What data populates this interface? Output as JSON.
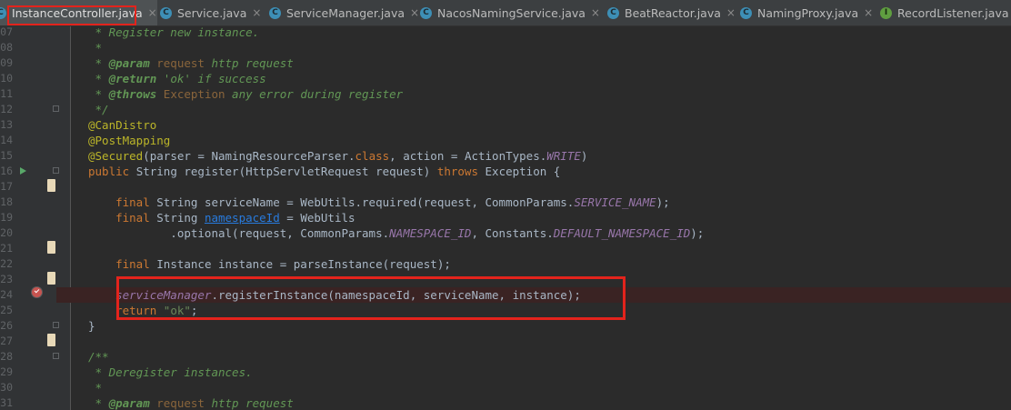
{
  "tabs": [
    {
      "label": "InstanceController.java",
      "icon": "class",
      "active": true
    },
    {
      "label": "Service.java",
      "icon": "class"
    },
    {
      "label": "ServiceManager.java",
      "icon": "class"
    },
    {
      "label": "NacosNamingService.java",
      "icon": "class"
    },
    {
      "label": "BeatReactor.java",
      "icon": "class"
    },
    {
      "label": "NamingProxy.java",
      "icon": "class"
    },
    {
      "label": "RecordListener.java",
      "icon": "interface"
    }
  ],
  "tab_close_glyph": "×",
  "icon_letters": {
    "class": "C",
    "interface": "I"
  },
  "code_lines": [
    {
      "n": "07",
      "parts": [
        {
          "t": " * Register new instance.",
          "c": "cm"
        }
      ]
    },
    {
      "n": "08",
      "parts": [
        {
          "t": " *",
          "c": "cm"
        }
      ]
    },
    {
      "n": "09",
      "parts": [
        {
          "t": " * ",
          "c": "cm"
        },
        {
          "t": "@param",
          "c": "ctag"
        },
        {
          "t": " request",
          "c": "cref"
        },
        {
          "t": " http request",
          "c": "cm"
        }
      ]
    },
    {
      "n": "10",
      "parts": [
        {
          "t": " * ",
          "c": "cm"
        },
        {
          "t": "@return",
          "c": "ctag"
        },
        {
          "t": " 'ok' if success",
          "c": "cm"
        }
      ]
    },
    {
      "n": "11",
      "parts": [
        {
          "t": " * ",
          "c": "cm"
        },
        {
          "t": "@throws",
          "c": "ctag"
        },
        {
          "t": " Exception",
          "c": "cref"
        },
        {
          "t": " any error during register",
          "c": "cm"
        }
      ]
    },
    {
      "n": "12",
      "parts": [
        {
          "t": " */",
          "c": "cm"
        }
      ]
    },
    {
      "n": "13",
      "parts": [
        {
          "t": "@CanDistro",
          "c": "ann"
        }
      ]
    },
    {
      "n": "14",
      "parts": [
        {
          "t": "@PostMapping",
          "c": "ann"
        }
      ]
    },
    {
      "n": "15",
      "parts": [
        {
          "t": "@Secured",
          "c": "ann"
        },
        {
          "t": "(parser = NamingResourceParser."
        },
        {
          "t": "class",
          "c": "kw"
        },
        {
          "t": ", action = ActionTypes."
        },
        {
          "t": "WRITE",
          "c": "cst"
        },
        {
          "t": ")"
        }
      ]
    },
    {
      "n": "16",
      "parts": [
        {
          "t": "public ",
          "c": "kw"
        },
        {
          "t": "String register(HttpServletRequest request) "
        },
        {
          "t": "throws ",
          "c": "kw"
        },
        {
          "t": "Exception {"
        }
      ]
    },
    {
      "n": "17",
      "parts": []
    },
    {
      "n": "18",
      "parts": [
        {
          "t": "    "
        },
        {
          "t": "final ",
          "c": "kw"
        },
        {
          "t": "String serviceName = WebUtils.required(request, CommonParams."
        },
        {
          "t": "SERVICE_NAME",
          "c": "cst"
        },
        {
          "t": ");"
        }
      ]
    },
    {
      "n": "19",
      "parts": [
        {
          "t": "    "
        },
        {
          "t": "final ",
          "c": "kw"
        },
        {
          "t": "String "
        },
        {
          "t": "namespaceId",
          "c": "ulink"
        },
        {
          "t": " = WebUtils"
        }
      ]
    },
    {
      "n": "20",
      "parts": [
        {
          "t": "            .optional(request, CommonParams."
        },
        {
          "t": "NAMESPACE_ID",
          "c": "cst"
        },
        {
          "t": ", Constants."
        },
        {
          "t": "DEFAULT_NAMESPACE_ID",
          "c": "cst"
        },
        {
          "t": ");"
        }
      ]
    },
    {
      "n": "21",
      "parts": []
    },
    {
      "n": "22",
      "parts": [
        {
          "t": "    "
        },
        {
          "t": "final ",
          "c": "kw"
        },
        {
          "t": "Instance instance = parseInstance(request);"
        }
      ]
    },
    {
      "n": "23",
      "parts": []
    },
    {
      "n": "24",
      "bp": true,
      "parts": [
        {
          "t": "    serviceManager",
          "c": "cst"
        },
        {
          "t": ".registerInstance(namespaceId, serviceName, instance);"
        }
      ]
    },
    {
      "n": "25",
      "parts": [
        {
          "t": "    "
        },
        {
          "t": "return ",
          "c": "kw"
        },
        {
          "t": "\"ok\"",
          "c": "str"
        },
        {
          "t": ";"
        }
      ]
    },
    {
      "n": "26",
      "parts": [
        {
          "t": "}"
        }
      ]
    },
    {
      "n": "27",
      "parts": []
    },
    {
      "n": "28",
      "parts": [
        {
          "t": "/**",
          "c": "cm"
        }
      ]
    },
    {
      "n": "29",
      "parts": [
        {
          "t": " * Deregister instances.",
          "c": "cm"
        }
      ]
    },
    {
      "n": "30",
      "parts": [
        {
          "t": " *",
          "c": "cm"
        }
      ]
    },
    {
      "n": "31",
      "parts": [
        {
          "t": " * ",
          "c": "cm"
        },
        {
          "t": "@param",
          "c": "ctag"
        },
        {
          "t": " request",
          "c": "cref"
        },
        {
          "t": " http request",
          "c": "cm"
        }
      ]
    }
  ],
  "colors": {
    "editor_bg": "#2b2b2b",
    "gutter_bg": "#313335",
    "tab_bar_bg": "#3c3f41",
    "highlight_box": "#e3231c",
    "keyword": "#cc7832",
    "annotation": "#bbb529",
    "comment": "#629755",
    "string": "#6a8759",
    "constant": "#9876aa",
    "breakpoint_line_bg": "#3a2323"
  },
  "icons": [
    "class-file-icon",
    "interface-file-icon",
    "close-icon",
    "run-gutter-icon",
    "breakpoint-icon",
    "change-marker-icon",
    "fold-icon"
  ]
}
